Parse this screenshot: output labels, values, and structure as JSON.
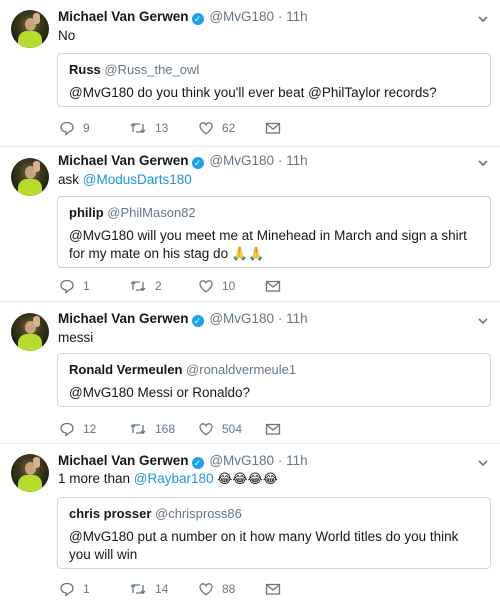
{
  "tweets": [
    {
      "author": "Michael Van Gerwen",
      "handle": "@MvG180",
      "dot": "·",
      "time": "11h",
      "text": "No",
      "quote": {
        "name": "Russ",
        "handle": "@Russ_the_owl",
        "text": "@MvG180 do you think you'll ever beat @PhilTaylor records?"
      },
      "stats": {
        "replies": "9",
        "retweets": "13",
        "likes": "62"
      }
    },
    {
      "author": "Michael Van Gerwen",
      "handle": "@MvG180",
      "dot": "·",
      "time": "11h",
      "text_prefix": "ask ",
      "text_mention": "@ModusDarts180",
      "quote": {
        "name": "philip",
        "handle": "@PhilMason82",
        "text": "@MvG180 will you meet me at Minehead in March and sign a shirt for my mate on his stag do",
        "emoji": "🙏🙏"
      },
      "stats": {
        "replies": "1",
        "retweets": "2",
        "likes": "10"
      }
    },
    {
      "author": "Michael Van Gerwen",
      "handle": "@MvG180",
      "dot": "·",
      "time": "11h",
      "text": "messi",
      "quote": {
        "name": "Ronald Vermeulen",
        "handle": "@ronaldvermeule1",
        "text": "@MvG180 Messi or Ronaldo?"
      },
      "stats": {
        "replies": "12",
        "retweets": "168",
        "likes": "504"
      }
    },
    {
      "author": "Michael Van Gerwen",
      "handle": "@MvG180",
      "dot": "·",
      "time": "11h",
      "text_prefix": "1 more than ",
      "text_mention": "@Raybar180",
      "text_emoji": " 😂😂😂😂",
      "quote": {
        "name": "chris prosser",
        "handle": "@chrispross86",
        "text": "@MvG180 put a number on it how many World titles do you think you will win"
      },
      "stats": {
        "replies": "1",
        "retweets": "14",
        "likes": "88"
      }
    }
  ],
  "colors": {
    "accent": "#1b95e0",
    "verified": "#1da1f2",
    "muted": "#657786",
    "border": "#ccd6dd"
  },
  "icons": [
    "chevron-down-icon",
    "verified-badge-icon",
    "reply-icon",
    "retweet-icon",
    "like-icon",
    "message-icon"
  ]
}
